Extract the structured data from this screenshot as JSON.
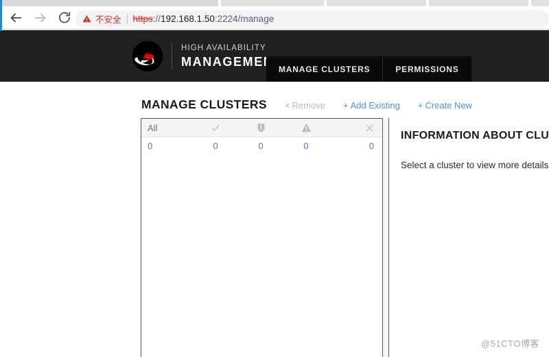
{
  "browser": {
    "nav": {
      "back": "back-arrow",
      "forward": "forward-arrow",
      "reload": "reload"
    },
    "omnibox": {
      "security_icon": "warning-triangle-icon",
      "security_label": "不安全",
      "url_scheme": "https",
      "url_separator": "://",
      "url_host": "192.168.1.50",
      "url_rest": ":2224/manage"
    }
  },
  "header": {
    "logo": "red-hat-logo",
    "brand_line1": "HIGH AVAILABILITY",
    "brand_line2": "MANAGEMENT",
    "tabs": [
      {
        "label": "MANAGE CLUSTERS"
      },
      {
        "label": "PERMISSIONS"
      }
    ]
  },
  "main": {
    "section_title": "MANAGE CLUSTERS",
    "actions": [
      {
        "symbol": "×",
        "label": "Remove",
        "state": "disabled"
      },
      {
        "symbol": "+",
        "label": "Add Existing",
        "state": "enabled"
      },
      {
        "symbol": "+",
        "label": "Create New",
        "state": "enabled"
      }
    ],
    "table": {
      "columns": [
        {
          "label": "All",
          "icon": ""
        },
        {
          "label": "",
          "icon": "check-icon"
        },
        {
          "label": "",
          "icon": "shield-alert-icon"
        },
        {
          "label": "",
          "icon": "warning-triangle-icon"
        },
        {
          "label": "",
          "icon": "close-x-icon"
        }
      ],
      "rows": [
        [
          "0",
          "0",
          "0",
          "0",
          "0"
        ]
      ]
    },
    "info_panel": {
      "title": "INFORMATION ABOUT CLUSTER",
      "subtitle": "Select a cluster to view more details"
    }
  },
  "watermark": "@51CTO博客",
  "colors": {
    "accent_blue": "#3f7fd4",
    "header_dark": "#1d1d1d",
    "tab_black": "#0a0a0a",
    "insecure_red": "#d93025",
    "edge_blue": "#1e8ad6"
  }
}
